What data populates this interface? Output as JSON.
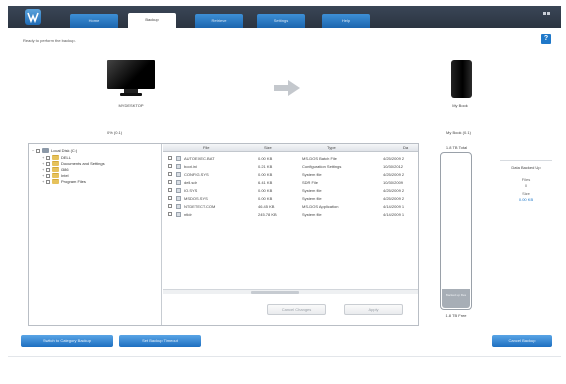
{
  "tabs": [
    {
      "label": "Home",
      "active": false
    },
    {
      "label": "Backup",
      "active": true
    },
    {
      "label": "Retrieve",
      "active": false
    },
    {
      "label": "Settings",
      "active": false
    },
    {
      "label": "Help",
      "active": false
    }
  ],
  "status_text": "Ready to perform the backup.",
  "help_glyph": "?",
  "computer": {
    "name": "MYDESKTOP",
    "selected_size": "0% (0.1)"
  },
  "drive": {
    "name": "My Book",
    "label": "My Book (0.1)"
  },
  "tree": [
    {
      "label": "Local Disk (C:)",
      "type": "drive",
      "expander": "−"
    },
    {
      "label": "DELL",
      "type": "folder",
      "expander": "+"
    },
    {
      "label": "Documents and Settings",
      "type": "folder",
      "expander": "+"
    },
    {
      "label": "i386",
      "type": "folder",
      "expander": "+"
    },
    {
      "label": "Intel",
      "type": "folder",
      "expander": "+"
    },
    {
      "label": "Program Files",
      "type": "folder",
      "expander": "+"
    }
  ],
  "file_table": {
    "columns": [
      "File",
      "Size",
      "Type",
      "Da"
    ],
    "rows": [
      {
        "file": "AUTOEXEC.BAT",
        "size": "0.00 KB",
        "type": "MS-DOS Batch File",
        "date": "4/25/2009 2"
      },
      {
        "file": "boot.ini",
        "size": "0.21 KB",
        "type": "Configuration Settings",
        "date": "10/30/2012"
      },
      {
        "file": "CONFIG.SYS",
        "size": "0.00 KB",
        "type": "System file",
        "date": "4/25/2009 2"
      },
      {
        "file": "dell.sdr",
        "size": "6.41 KB",
        "type": "SDR File",
        "date": "10/30/2009"
      },
      {
        "file": "IO.SYS",
        "size": "0.00 KB",
        "type": "System file",
        "date": "4/25/2009 2"
      },
      {
        "file": "MSDOS.SYS",
        "size": "0.00 KB",
        "type": "System file",
        "date": "4/25/2009 2"
      },
      {
        "file": "NTDETECT.COM",
        "size": "46.45 KB",
        "type": "MS-DOS Application",
        "date": "4/14/2009 1"
      },
      {
        "file": "ntldr",
        "size": "245.78 KB",
        "type": "System file",
        "date": "4/14/2009 1"
      }
    ],
    "buttons": [
      "Cancel Changes",
      "Apply"
    ]
  },
  "capacity": {
    "total_label": "1.8 TB Total",
    "used_label": "Backed up files",
    "free_label": "1.8 TB Free",
    "used_fraction": 0.12
  },
  "side_info": {
    "title": "Data Backed Up",
    "line1": "Files",
    "line2": "0",
    "line3": "Size",
    "line4": "0.00 KB"
  },
  "bottom_buttons": [
    "Switch to Category Backup",
    "Set Backup Timeout",
    "Cancel Backup"
  ]
}
